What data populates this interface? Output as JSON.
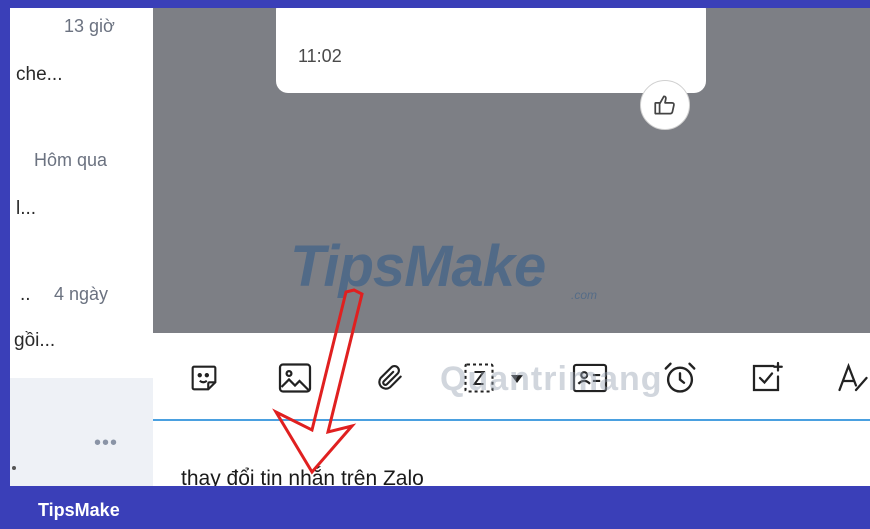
{
  "sidebar": {
    "items": [
      {
        "time": "13 giờ",
        "preview": "che..."
      },
      {
        "time": "Hôm qua",
        "preview": "l..."
      },
      {
        "time": "4 ngày",
        "lead": "..",
        "preview": "gồi..."
      }
    ],
    "more_label": "•••"
  },
  "chat": {
    "message_time": "11:02"
  },
  "watermark": {
    "brand": "TipsMake",
    "com": ".com",
    "second": "Quantrimang"
  },
  "composer": {
    "text": "thay đổi tin nhắn trên Zalo"
  },
  "footer": {
    "brand": "TipsMake"
  },
  "colors": {
    "frame": "#3a3fb8",
    "chat_bg": "#7d7f85",
    "accent_line": "#4aa0e0",
    "arrow": "#e02020"
  }
}
